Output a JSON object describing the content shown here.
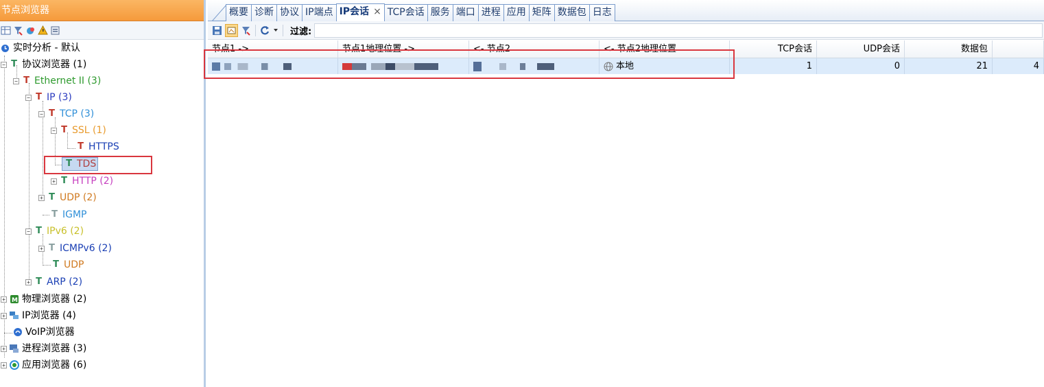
{
  "left_panel": {
    "title": "节点浏览器",
    "toolbar_icons": [
      "table-icon",
      "filter-icon",
      "refresh-icon",
      "alert-icon",
      "export-icon"
    ],
    "tree": [
      {
        "label": "实时分析 - 默认",
        "color": "#000000",
        "icon": "clock-icon",
        "level": 0
      },
      {
        "label": "协议浏览器 (1)",
        "color": "#000000",
        "icon": "protocol-icon",
        "level": 0
      },
      {
        "label": "Ethernet II (3)",
        "color": "#2e9a2e",
        "icon": "protocol-icon",
        "level": 1
      },
      {
        "label": "IP (3)",
        "color": "#2b3bbf",
        "icon": "protocol-icon",
        "level": 2
      },
      {
        "label": "TCP (3)",
        "color": "#2f8fd8",
        "icon": "protocol-icon",
        "level": 3
      },
      {
        "label": "SSL (1)",
        "color": "#e89a2c",
        "icon": "protocol-icon",
        "level": 4
      },
      {
        "label": "HTTPS",
        "color": "#1a3fb4",
        "icon": "protocol-icon",
        "level": 5
      },
      {
        "label": "TDS",
        "color": "#b04040",
        "icon": "protocol-icon",
        "level": 4
      },
      {
        "label": "HTTP (2)",
        "color": "#c63fbf",
        "icon": "protocol-icon",
        "level": 4
      },
      {
        "label": "UDP (2)",
        "color": "#d07a20",
        "icon": "protocol-icon",
        "level": 3
      },
      {
        "label": "IGMP",
        "color": "#2f8fd8",
        "icon": "protocol-icon",
        "level": 3
      },
      {
        "label": "IPv6 (2)",
        "color": "#c8c02a",
        "icon": "protocol-icon",
        "level": 2
      },
      {
        "label": "ICMPv6 (2)",
        "color": "#1a3fb4",
        "icon": "protocol-icon",
        "level": 3
      },
      {
        "label": "UDP",
        "color": "#d07a20",
        "icon": "protocol-icon",
        "level": 3
      },
      {
        "label": "ARP (2)",
        "color": "#1a3fb4",
        "icon": "protocol-icon",
        "level": 2
      },
      {
        "label": "物理浏览器 (2)",
        "color": "#000000",
        "icon": "physical-icon",
        "level": 0
      },
      {
        "label": "IP浏览器 (4)",
        "color": "#000000",
        "icon": "network-icon",
        "level": 0
      },
      {
        "label": "VoIP浏览器",
        "color": "#000000",
        "icon": "voip-icon",
        "level": 0
      },
      {
        "label": "进程浏览器 (3)",
        "color": "#000000",
        "icon": "process-icon",
        "level": 0
      },
      {
        "label": "应用浏览器 (6)",
        "color": "#000000",
        "icon": "app-icon",
        "level": 0
      }
    ]
  },
  "tabs": [
    {
      "label": "概要"
    },
    {
      "label": "诊断"
    },
    {
      "label": "协议"
    },
    {
      "label": "IP端点"
    },
    {
      "label": "IP会话",
      "active": true,
      "close": "×"
    },
    {
      "label": "TCP会话"
    },
    {
      "label": "服务"
    },
    {
      "label": "端口"
    },
    {
      "label": "进程"
    },
    {
      "label": "应用"
    },
    {
      "label": "矩阵"
    },
    {
      "label": "数据包"
    },
    {
      "label": "日志"
    }
  ],
  "toolbar": {
    "filter_label": "过滤:",
    "filter_value": "",
    "icons": [
      "save-icon",
      "node-icon",
      "filter-icon",
      "refresh-icon",
      "dropdown-icon"
    ]
  },
  "grid": {
    "columns": [
      "节点1 ->",
      "节点1地理位置 ->",
      "<- 节点2",
      "<- 节点2地理位置",
      "TCP会话",
      "UDP会话",
      "数据包",
      ""
    ],
    "row": {
      "node2_geo": "本地",
      "tcp": "1",
      "udp": "0",
      "packets": "21",
      "extra": "4"
    }
  },
  "colors": {
    "title_bar": "#f7a54a",
    "selection": "#c6d9f1",
    "highlight_box": "#d9363e",
    "row_bg": "#dcebfb"
  }
}
